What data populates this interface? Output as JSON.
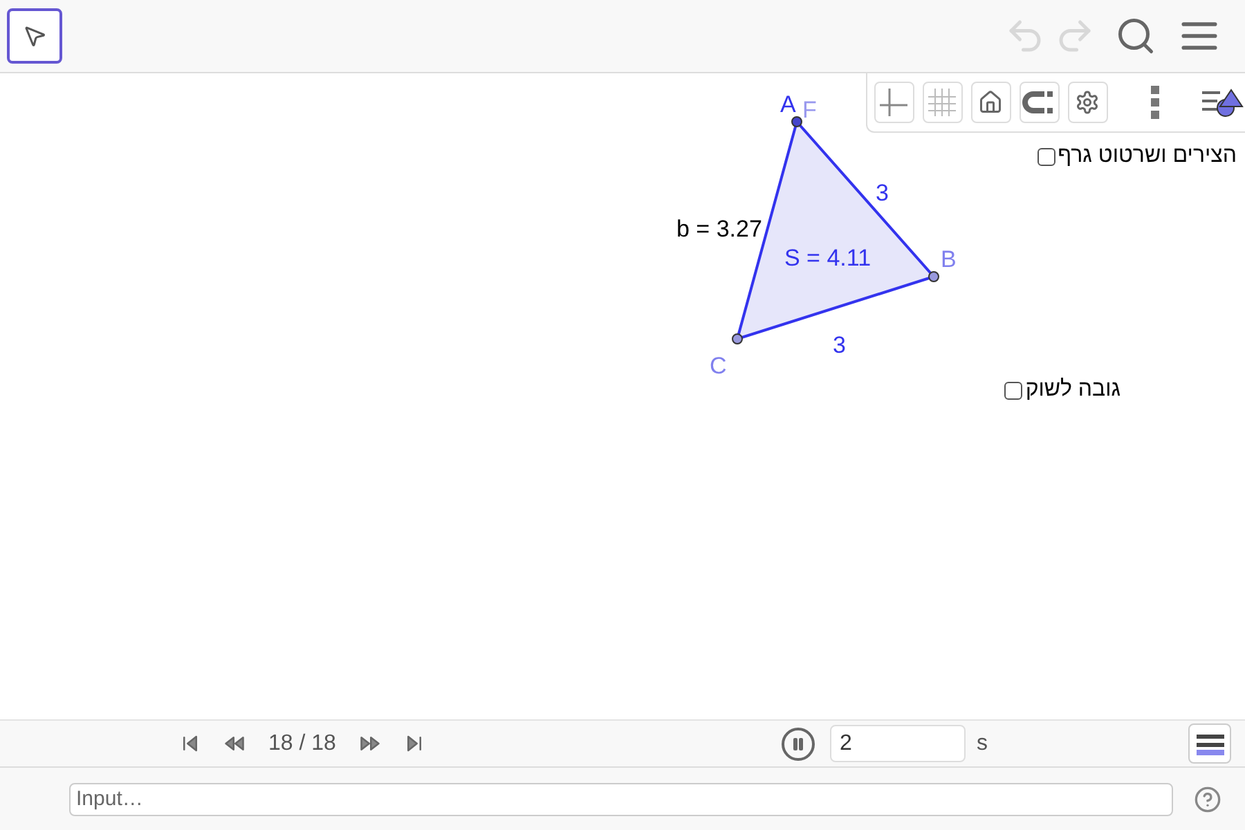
{
  "toolbar": {
    "undo": {
      "disabled": true
    },
    "redo": {
      "disabled": true
    }
  },
  "graphics": {
    "points": [
      {
        "label": "A"
      },
      {
        "label": "B"
      },
      {
        "label": "C"
      }
    ],
    "extra_label": "F",
    "side_labels": [
      "3",
      "3"
    ],
    "length_label": "b = 3.27",
    "area_label": "S = 4.11",
    "checkboxes": [
      {
        "label": "הצירים ושרטוט גרף",
        "checked": false
      },
      {
        "label": "גובה לשוק",
        "checked": false
      }
    ]
  },
  "player": {
    "counter": "18 / 18",
    "playing": true,
    "speed": "2",
    "unit": "s"
  },
  "input_bar": {
    "placeholder": "Input…"
  }
}
